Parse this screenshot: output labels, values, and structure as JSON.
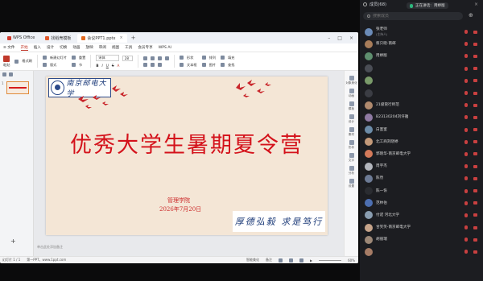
{
  "wps": {
    "tabs": [
      {
        "label": "WPS Office",
        "color": "#d13b2e"
      },
      {
        "label": "找稻壳模板",
        "color": "#e0582b"
      },
      {
        "label": "会议PPT1.pptx",
        "color": "#e36a1f"
      }
    ],
    "new_tab": "+",
    "menu": [
      "≡ 文件",
      "开始",
      "插入",
      "设计",
      "切换",
      "动画",
      "放映",
      "审阅",
      "视图",
      "工具",
      "会员专享",
      "WPS AI"
    ],
    "menu_active_index": 1,
    "ribbon": {
      "paste": "粘贴",
      "format_painter": "格式刷",
      "new_slide": "新建幻灯片",
      "layout": "版式",
      "section": "节",
      "reset": "重置",
      "font": "宋体",
      "font_size": "28",
      "shapes": "形状",
      "arrange": "排列",
      "textbox": "文本框",
      "picture": "图片",
      "fill": "填充",
      "find": "查找",
      "replace": "替换"
    },
    "slide": {
      "logo_text": "南京邮电大学",
      "title": "优秀大学生暑期夏令营",
      "org": "管理学院",
      "date": "2026年7月20日",
      "motto": "厚德弘毅 求是笃行"
    },
    "notes_placeholder": "单击此处添加备注",
    "slide_number": "1",
    "right_panel": [
      "对象美化",
      "动画",
      "模板",
      "设计",
      "素材",
      "形状",
      "文字",
      "分析",
      "设置"
    ],
    "status": {
      "slide_count": "幻灯片 1 / 1",
      "theme": "第一PPT，www.1ppt.com",
      "notes_toggle": "智能美化",
      "comments": "备注",
      "zoom": "60%"
    }
  },
  "members": {
    "header": "成员(68)",
    "speaking_label": "正在讲话:",
    "speaking_name": "用婷版",
    "search_placeholder": "搜索成员",
    "list": [
      {
        "name": "张老师",
        "role": "(主持人)",
        "color": "#6b8bb8"
      },
      {
        "name": "蔡只晓-南邮",
        "role": "",
        "color": "#a87d5a"
      },
      {
        "name": "周婷版",
        "role": "",
        "color": "#5f8f6f"
      },
      {
        "name": "",
        "role": "",
        "color": "#4a4d55"
      },
      {
        "name": "",
        "role": "",
        "color": "#7a9b6a"
      },
      {
        "name": "",
        "role": "",
        "color": "#3b3d44"
      },
      {
        "name": "21级管行师范",
        "role": "",
        "color": "#b08a6e"
      },
      {
        "name": "B23130204刘许雅",
        "role": "",
        "color": "#8f7aa3"
      },
      {
        "name": "白蜜蜜",
        "role": "",
        "color": "#6c8ca8"
      },
      {
        "name": "北工商刘晓婷",
        "role": "",
        "color": "#c49a7a"
      },
      {
        "name": "郭晓华-南京邮电大学",
        "role": "",
        "color": "#d47a5a"
      },
      {
        "name": "周宇杰",
        "role": "",
        "color": "#b3b6bd"
      },
      {
        "name": "陈然",
        "role": "",
        "color": "#6d7b96"
      },
      {
        "name": "陈一恢",
        "role": "",
        "color": "#2a2c31"
      },
      {
        "name": "范林伯",
        "role": "",
        "color": "#4d6fb1"
      },
      {
        "name": "付诺 河北大学",
        "role": "",
        "color": "#8a9db0"
      },
      {
        "name": "甘笑笑-南京邮电大学",
        "role": "",
        "color": "#c7a48a"
      },
      {
        "name": "胡丽瑞",
        "role": "",
        "color": "#9d8877"
      },
      {
        "name": "",
        "role": "",
        "color": "#a67c66"
      }
    ]
  }
}
